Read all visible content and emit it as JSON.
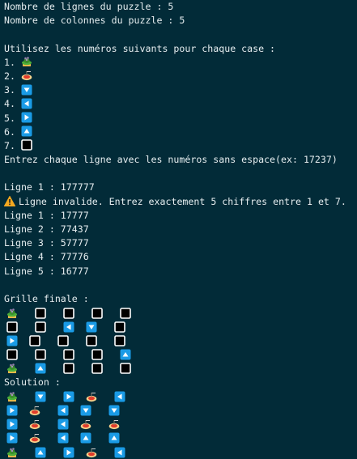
{
  "colors": {
    "background": "#022b38",
    "text": "#e6eef0",
    "arrow_blue": "#1a9be6",
    "warning": "#f3a820"
  },
  "header": {
    "rows_line": "Nombre de lignes du puzzle : 5",
    "cols_line": "Nombre de colonnes du puzzle : 5"
  },
  "legend": {
    "intro": "Utilisez les numéros suivants pour chaque case :",
    "items": [
      {
        "num": "1.",
        "icon": "potted-plant"
      },
      {
        "num": "2.",
        "icon": "spaghetti"
      },
      {
        "num": "3.",
        "icon": "arrow-down"
      },
      {
        "num": "4.",
        "icon": "arrow-left"
      },
      {
        "num": "5.",
        "icon": "arrow-right"
      },
      {
        "num": "6.",
        "icon": "arrow-up"
      },
      {
        "num": "7.",
        "icon": "empty-box"
      }
    ]
  },
  "prompt": "Entrez chaque ligne avec les numéros sans espace(ex: 17237)",
  "inputs": [
    "Ligne 1 : 177777"
  ],
  "warning": {
    "icon": "warning",
    "text": "Ligne invalide. Entrez exactement 5 chiffres entre 1 et 7."
  },
  "valid_inputs": [
    "Ligne 1 : 17777",
    "Ligne 2 : 77437",
    "Ligne 3 : 57777",
    "Ligne 4 : 77776",
    "Ligne 5 : 16777"
  ],
  "grid_title": "Grille finale :",
  "grid": [
    [
      1,
      7,
      7,
      7,
      7
    ],
    [
      7,
      7,
      4,
      3,
      7
    ],
    [
      5,
      7,
      7,
      7,
      7
    ],
    [
      7,
      7,
      7,
      7,
      6
    ],
    [
      1,
      6,
      7,
      7,
      7
    ]
  ],
  "solution_title": "Solution :",
  "solution": [
    [
      1,
      3,
      5,
      2,
      4
    ],
    [
      5,
      2,
      4,
      3,
      3
    ],
    [
      5,
      2,
      4,
      2,
      2
    ],
    [
      5,
      2,
      4,
      6,
      6
    ],
    [
      1,
      6,
      5,
      2,
      4
    ]
  ]
}
